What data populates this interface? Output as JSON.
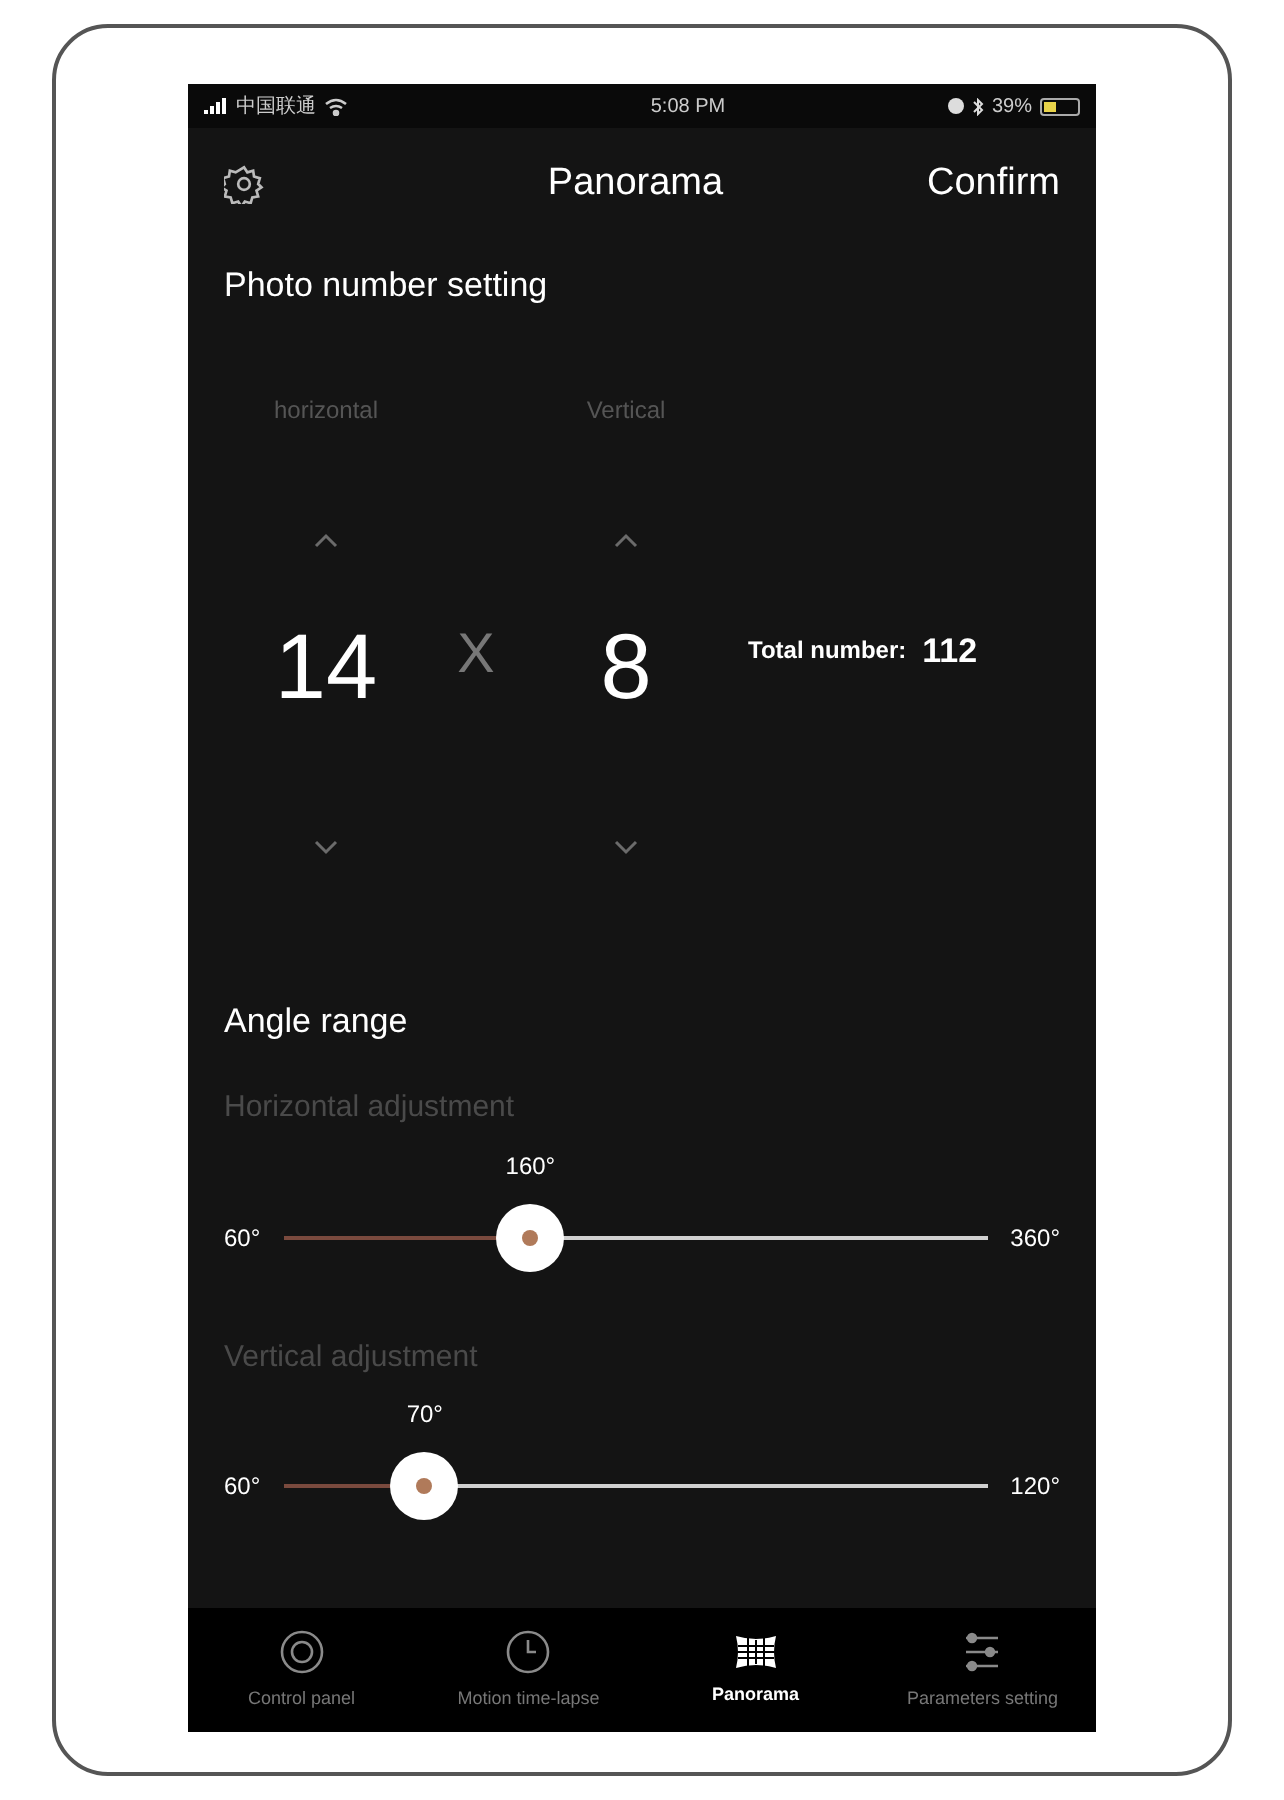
{
  "status_bar": {
    "carrier": "中国联通",
    "time": "5:08 PM",
    "battery": "39%"
  },
  "nav": {
    "title": "Panorama",
    "action": "Confirm"
  },
  "photo_section": {
    "title": "Photo number setting",
    "pickers": [
      {
        "label": "horizontal",
        "value": "14"
      },
      {
        "label": "Vertical",
        "value": "8"
      }
    ],
    "separator": "X",
    "total_label": "Total number:",
    "total_value": "112"
  },
  "angle_section": {
    "title": "Angle range",
    "sliders": [
      {
        "label": "Horizontal adjustment",
        "reading": "160°",
        "min": "60°",
        "max": "360°",
        "level": 0.35
      },
      {
        "label": "Vertical adjustment",
        "reading": "70°",
        "min": "60°",
        "max": "120°",
        "level": 0.2
      }
    ]
  },
  "tabs": [
    {
      "label": "Control panel",
      "kind": "dial",
      "selected": false
    },
    {
      "label": "Motion time-lapse",
      "kind": "clock",
      "selected": false
    },
    {
      "label": "Panorama",
      "kind": "grid",
      "selected": true
    },
    {
      "label": "Parameters setting",
      "kind": "sliders",
      "selected": false
    }
  ]
}
